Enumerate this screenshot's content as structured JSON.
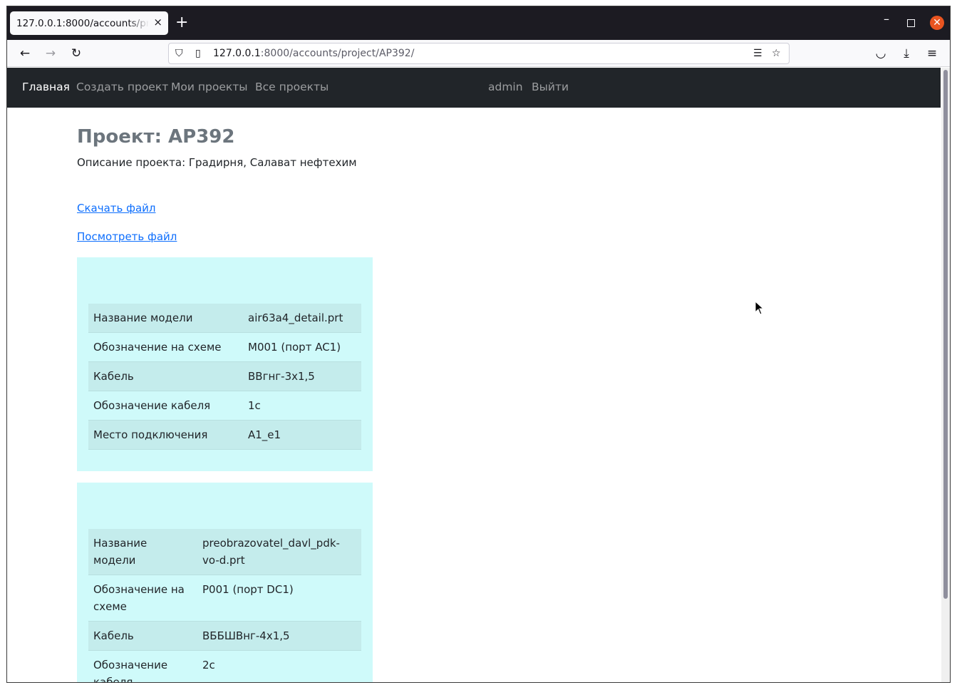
{
  "browser": {
    "tab_title": "127.0.0.1:8000/accounts/project/AP392/",
    "tab_close": "×",
    "new_tab": "+",
    "url_host": "127.0.0.1",
    "url_rest": ":8000/accounts/project/AP392/"
  },
  "site_nav": {
    "items": [
      "Главная",
      "Создать проект",
      "Мои проекты",
      "Все проекты"
    ],
    "user": "admin",
    "logout": "Выйти"
  },
  "project": {
    "title": "Проект: AP392",
    "description": "Описание проекта: Градирня, Салават нефтехим",
    "download_link": "Скачать файл",
    "view_link": "Посмотреть файл"
  },
  "cards": [
    {
      "rows": [
        [
          "Название модели",
          "air63a4_detail.prt"
        ],
        [
          "Обозначение на схеме",
          "M001 (порт AC1)"
        ],
        [
          "Кабель",
          "ВВгнг-3х1,5"
        ],
        [
          "Обозначение кабеля",
          "1c"
        ],
        [
          "Место подключения",
          "A1_e1"
        ]
      ]
    },
    {
      "rows": [
        [
          "Название модели",
          "preobrazovatel_davl_pdk-vo-d.prt"
        ],
        [
          "Обозначение на схеме",
          "P001 (порт DC1)"
        ],
        [
          "Кабель",
          "ВББШВнг-4х1,5"
        ],
        [
          "Обозначение кабеля",
          "2c"
        ]
      ]
    }
  ],
  "colors": {
    "navbar_bg": "#212529",
    "card_bg": "#cffafa",
    "link": "#0d6efd"
  }
}
